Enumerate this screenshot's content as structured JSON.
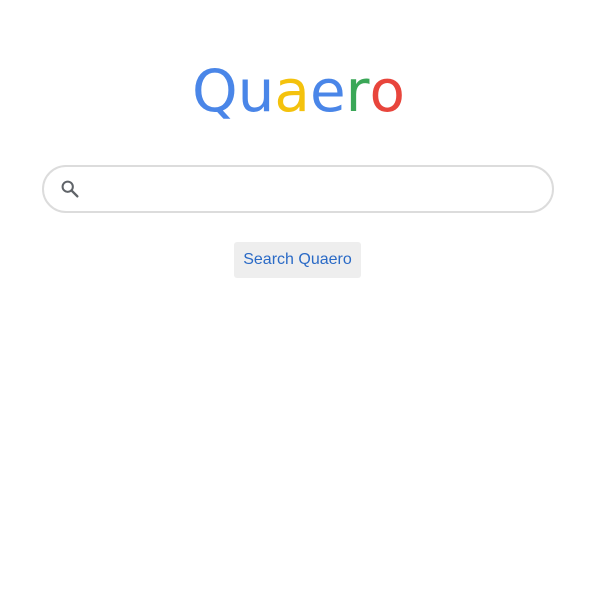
{
  "logo": {
    "letters": [
      {
        "char": "Q",
        "color": "#4a86e8"
      },
      {
        "char": "u",
        "color": "#4a86e8"
      },
      {
        "char": "a",
        "color": "#f4c20d"
      },
      {
        "char": "e",
        "color": "#4a86e8"
      },
      {
        "char": "r",
        "color": "#3aa757"
      },
      {
        "char": "o",
        "color": "#e8453c"
      }
    ]
  },
  "search": {
    "value": "",
    "placeholder": "",
    "icon": "search-icon"
  },
  "buttons": {
    "search_label": "Search Quaero"
  },
  "colors": {
    "button_text": "#2a6ac6",
    "button_bg": "#eeeeee",
    "search_border": "#dcdcdc",
    "icon": "#5f6368"
  }
}
